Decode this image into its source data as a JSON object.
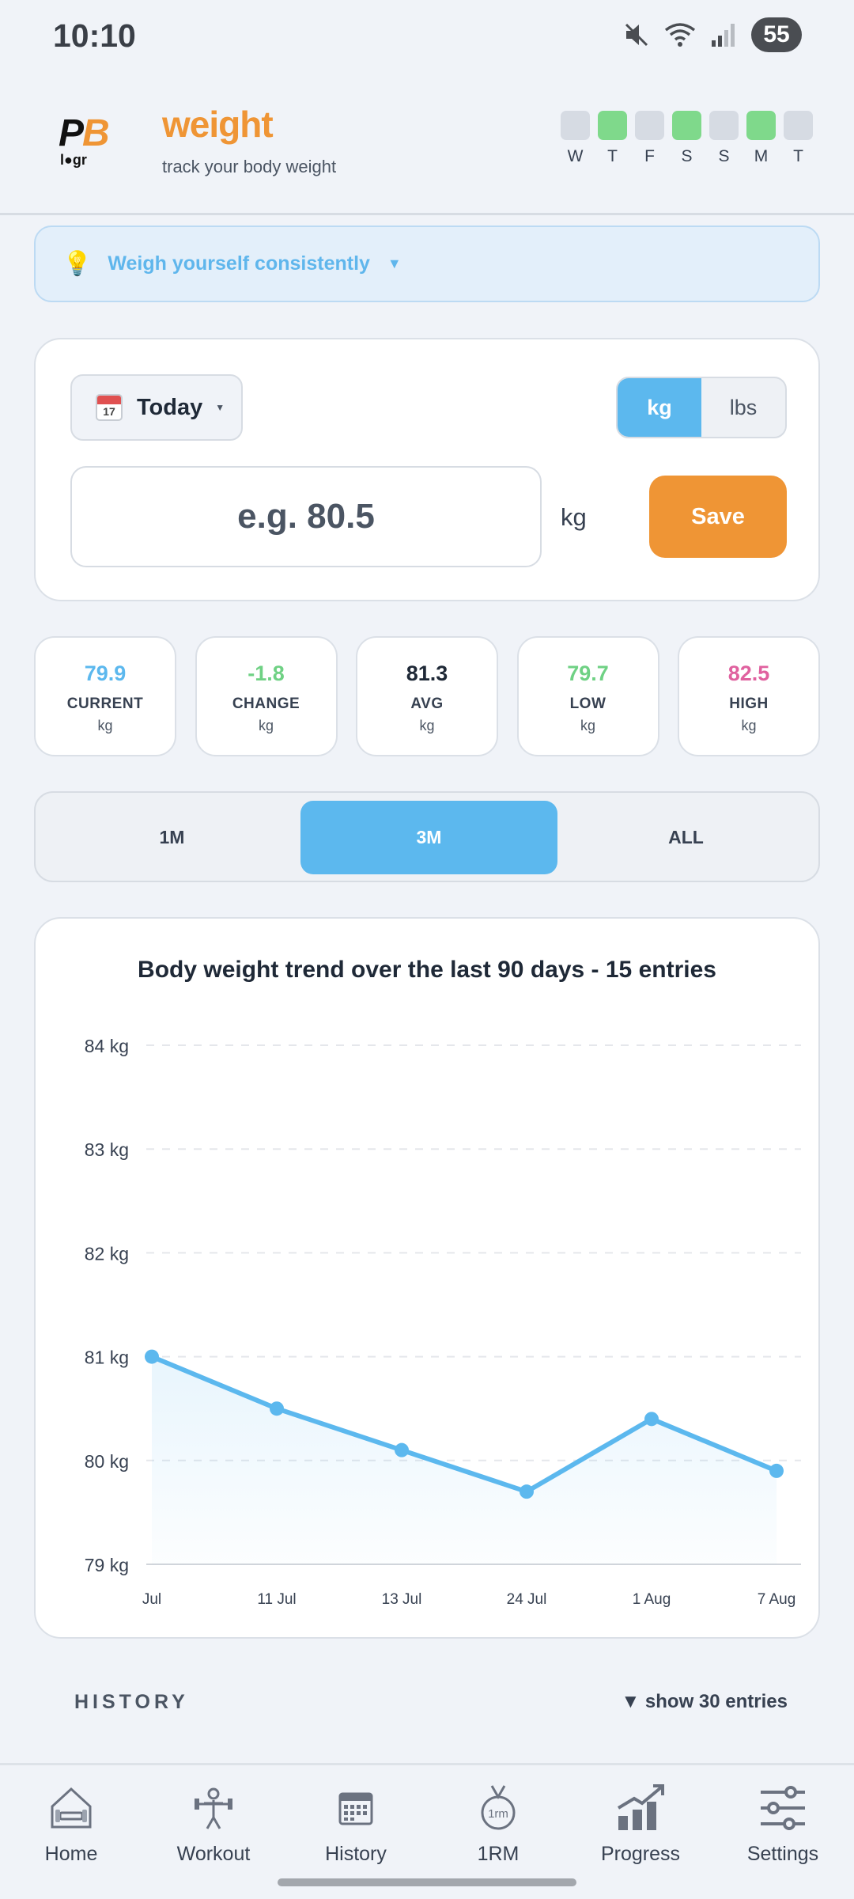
{
  "status_bar": {
    "time": "10:10",
    "battery": "55",
    "icons": [
      "mute-icon",
      "wifi-icon",
      "signal-icon",
      "battery-icon"
    ]
  },
  "header": {
    "logo_text": "PB logr",
    "title": "weight",
    "subtitle": "track your body weight",
    "week": [
      {
        "day": "W",
        "done": false
      },
      {
        "day": "T",
        "done": true
      },
      {
        "day": "F",
        "done": false
      },
      {
        "day": "S",
        "done": true
      },
      {
        "day": "S",
        "done": false
      },
      {
        "day": "M",
        "done": true
      },
      {
        "day": "T",
        "done": false
      }
    ]
  },
  "tip": {
    "icon": "lightbulb-icon",
    "text": "Weigh yourself consistently"
  },
  "entry": {
    "calendar_day": "17",
    "date_label": "Today",
    "units": [
      "kg",
      "lbs"
    ],
    "selected_unit": "kg",
    "input_placeholder": "e.g. 80.5",
    "input_value": "",
    "input_unit": "kg",
    "save_label": "Save"
  },
  "stats": [
    {
      "value": "79.9",
      "name": "CURRENT",
      "unit": "kg",
      "color": "#5cb8ee"
    },
    {
      "value": "-1.8",
      "name": "CHANGE",
      "unit": "kg",
      "color": "#6fd184"
    },
    {
      "value": "81.3",
      "name": "AVG",
      "unit": "kg",
      "color": "#1f2937"
    },
    {
      "value": "79.7",
      "name": "LOW",
      "unit": "kg",
      "color": "#6fd184"
    },
    {
      "value": "82.5",
      "name": "HIGH",
      "unit": "kg",
      "color": "#e0619f"
    }
  ],
  "ranges": {
    "options": [
      "1M",
      "3M",
      "ALL"
    ],
    "selected": "3M"
  },
  "chart_data": {
    "type": "line",
    "title": "Body weight trend over the last 90 days - 15 entries",
    "x": [
      "Jul",
      "11 Jul",
      "13 Jul",
      "24 Jul",
      "1 Aug",
      "7 Aug"
    ],
    "series": [
      {
        "values": [
          81.0,
          80.5,
          80.1,
          79.7,
          80.4,
          79.9
        ]
      }
    ],
    "y_ticks": [
      "84 kg",
      "83 kg",
      "82 kg",
      "81 kg",
      "80 kg",
      "79 kg"
    ],
    "ylim": [
      79,
      84
    ],
    "grid": true,
    "line_color": "#5cb8ee"
  },
  "history": {
    "label": "HISTORY",
    "toggle_label": "▼ show 30 entries"
  },
  "nav": [
    {
      "label": "Home",
      "icon": "home-icon"
    },
    {
      "label": "Workout",
      "icon": "workout-icon"
    },
    {
      "label": "History",
      "icon": "calendar-icon"
    },
    {
      "label": "1RM",
      "icon": "medal-icon"
    },
    {
      "label": "Progress",
      "icon": "progress-chart-icon"
    },
    {
      "label": "Settings",
      "icon": "settings-sliders-icon"
    }
  ]
}
